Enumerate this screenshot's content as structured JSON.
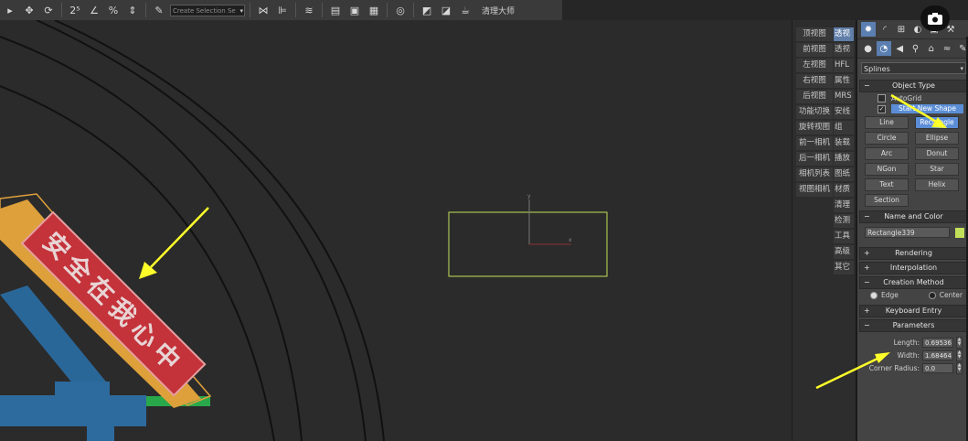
{
  "toolbar": {
    "icons": [
      "select-filter-icon",
      "select-move-icon",
      "select-rotate-icon",
      "snap-toggle-icon",
      "angle-snap-icon",
      "percent-snap-icon",
      "spinner-snap-icon",
      "edit-named-selection-icon",
      "mirror-icon",
      "align-icon",
      "layer-icon",
      "schematic-icon",
      "material-editor-icon",
      "render-setup-icon",
      "render-frame-icon",
      "render-production-icon",
      "render-iterative-icon",
      "teapot-icon",
      "plugin-icon"
    ],
    "selection_set_placeholder": "Create Selection Se",
    "plugin_label": "清理大师"
  },
  "viewport": {
    "banner_text": "安全在我心中"
  },
  "viewport_menu": {
    "col1": [
      "顶视图",
      "前视图",
      "左视图",
      "右视图",
      "后视图",
      "功能切换",
      "旋转视图",
      "前一相机",
      "后一相机",
      "相机列表",
      "视图相机"
    ],
    "col2": [
      "透视",
      "透视",
      "HFL",
      "属性",
      "MRS",
      "安线",
      "组",
      "装载",
      "播放",
      "图纸",
      "材质",
      "清理",
      "检测",
      "工具",
      "高级",
      "其它"
    ]
  },
  "command_panel": {
    "category_dropdown": "Splines",
    "object_type": {
      "title": "Object Type",
      "autogrid_label": "AutoGrid",
      "start_new_shape_label": "Start New Shape",
      "buttons": [
        "Line",
        "Rectangle",
        "Circle",
        "Ellipse",
        "Arc",
        "Donut",
        "NGon",
        "Star",
        "Text",
        "Helix",
        "Section"
      ],
      "active_button": "Rectangle"
    },
    "name_and_color": {
      "title": "Name and Color",
      "name": "Rectangle339",
      "color": "#c3e05a"
    },
    "rollouts_collapsed": [
      "Rendering",
      "Interpolation"
    ],
    "creation_method": {
      "title": "Creation Method",
      "options": [
        "Edge",
        "Center"
      ],
      "selected": "Edge"
    },
    "keyboard_entry_title": "Keyboard Entry",
    "parameters": {
      "title": "Parameters",
      "length_label": "Length:",
      "length_value": "0.69536",
      "width_label": "Width:",
      "width_value": "1.68464",
      "corner_radius_label": "Corner Radius:",
      "corner_radius_value": "0.0"
    }
  },
  "accent_color": "#5b8ed6",
  "annotation_arrow_color": "#ffff2a"
}
